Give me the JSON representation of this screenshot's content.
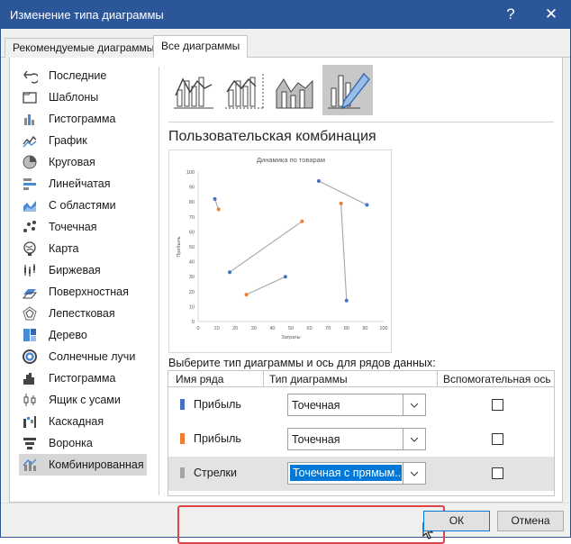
{
  "window": {
    "title": "Изменение типа диаграммы",
    "help": "?",
    "close": "✕"
  },
  "tabs": [
    {
      "label": "Рекомендуемые диаграммы",
      "active": false
    },
    {
      "label": "Все диаграммы",
      "active": true
    }
  ],
  "sidebar": {
    "items": [
      {
        "label": "Последние",
        "icon": "recent-icon"
      },
      {
        "label": "Шаблоны",
        "icon": "folder-icon"
      },
      {
        "label": "Гистограмма",
        "icon": "column-chart-icon"
      },
      {
        "label": "График",
        "icon": "line-chart-icon"
      },
      {
        "label": "Круговая",
        "icon": "pie-chart-icon"
      },
      {
        "label": "Линейчатая",
        "icon": "bar-chart-icon"
      },
      {
        "label": "С областями",
        "icon": "area-chart-icon"
      },
      {
        "label": "Точечная",
        "icon": "scatter-chart-icon"
      },
      {
        "label": "Карта",
        "icon": "map-chart-icon"
      },
      {
        "label": "Биржевая",
        "icon": "stock-chart-icon"
      },
      {
        "label": "Поверхностная",
        "icon": "surface-chart-icon"
      },
      {
        "label": "Лепестковая",
        "icon": "radar-chart-icon"
      },
      {
        "label": "Дерево",
        "icon": "treemap-chart-icon"
      },
      {
        "label": "Солнечные лучи",
        "icon": "sunburst-chart-icon"
      },
      {
        "label": "Гистограмма",
        "icon": "histogram-chart-icon"
      },
      {
        "label": "Ящик с усами",
        "icon": "box-whisker-chart-icon"
      },
      {
        "label": "Каскадная",
        "icon": "waterfall-chart-icon"
      },
      {
        "label": "Воронка",
        "icon": "funnel-chart-icon"
      },
      {
        "label": "Комбинированная",
        "icon": "combo-chart-icon",
        "active": true
      }
    ]
  },
  "subtypes": [
    {
      "name": "combo-column-line-icon",
      "active": false
    },
    {
      "name": "combo-column-line-secondary-icon",
      "active": false
    },
    {
      "name": "combo-area-column-icon",
      "active": false
    },
    {
      "name": "custom-combination-icon",
      "active": true
    }
  ],
  "main": {
    "heading": "Пользовательская комбинация",
    "prompt": "Выберите тип диаграммы и ось для рядов данных:",
    "columns": {
      "series": "Имя ряда",
      "type": "Тип диаграммы",
      "secondary": "Вспомогательная ось"
    },
    "rows": [
      {
        "name": "Прибыль",
        "color": "#4472c4",
        "type": "Точечная",
        "secondary": false,
        "selected": false
      },
      {
        "name": "Прибыль",
        "color": "#ed7d31",
        "type": "Точечная",
        "secondary": false,
        "selected": false
      },
      {
        "name": "Стрелки",
        "color": "#a5a5a5",
        "type": "Точечная с прямым...",
        "secondary": false,
        "selected": true
      }
    ]
  },
  "chart_data": {
    "type": "scatter",
    "title": "Динамика по товарам",
    "xlabel": "Затраты",
    "ylabel": "Прибыль",
    "xlim": [
      0,
      100
    ],
    "ylim": [
      0,
      100
    ],
    "xticks": [
      0,
      10,
      20,
      30,
      40,
      50,
      60,
      70,
      80,
      90,
      100
    ],
    "yticks": [
      0,
      10,
      20,
      30,
      40,
      50,
      60,
      70,
      80,
      90,
      100
    ],
    "grid": false,
    "series": [
      {
        "color": "#4472c4",
        "points": [
          [
            9,
            82
          ],
          [
            17,
            33
          ],
          [
            47,
            30
          ],
          [
            65,
            94
          ],
          [
            80,
            14
          ],
          [
            91,
            78
          ]
        ]
      },
      {
        "color": "#ed7d31",
        "points": [
          [
            11,
            75
          ],
          [
            26,
            18
          ],
          [
            56,
            67
          ],
          [
            77,
            79
          ]
        ]
      }
    ],
    "arrows": [
      [
        [
          9,
          82
        ],
        [
          11,
          75
        ]
      ],
      [
        [
          17,
          33
        ],
        [
          56,
          67
        ]
      ],
      [
        [
          26,
          18
        ],
        [
          47,
          30
        ]
      ],
      [
        [
          65,
          94
        ],
        [
          91,
          78
        ]
      ],
      [
        [
          77,
          79
        ],
        [
          80,
          14
        ]
      ]
    ],
    "arrow_color": "#a5a5a5"
  },
  "buttons": {
    "ok": "ОК",
    "cancel": "Отмена"
  }
}
